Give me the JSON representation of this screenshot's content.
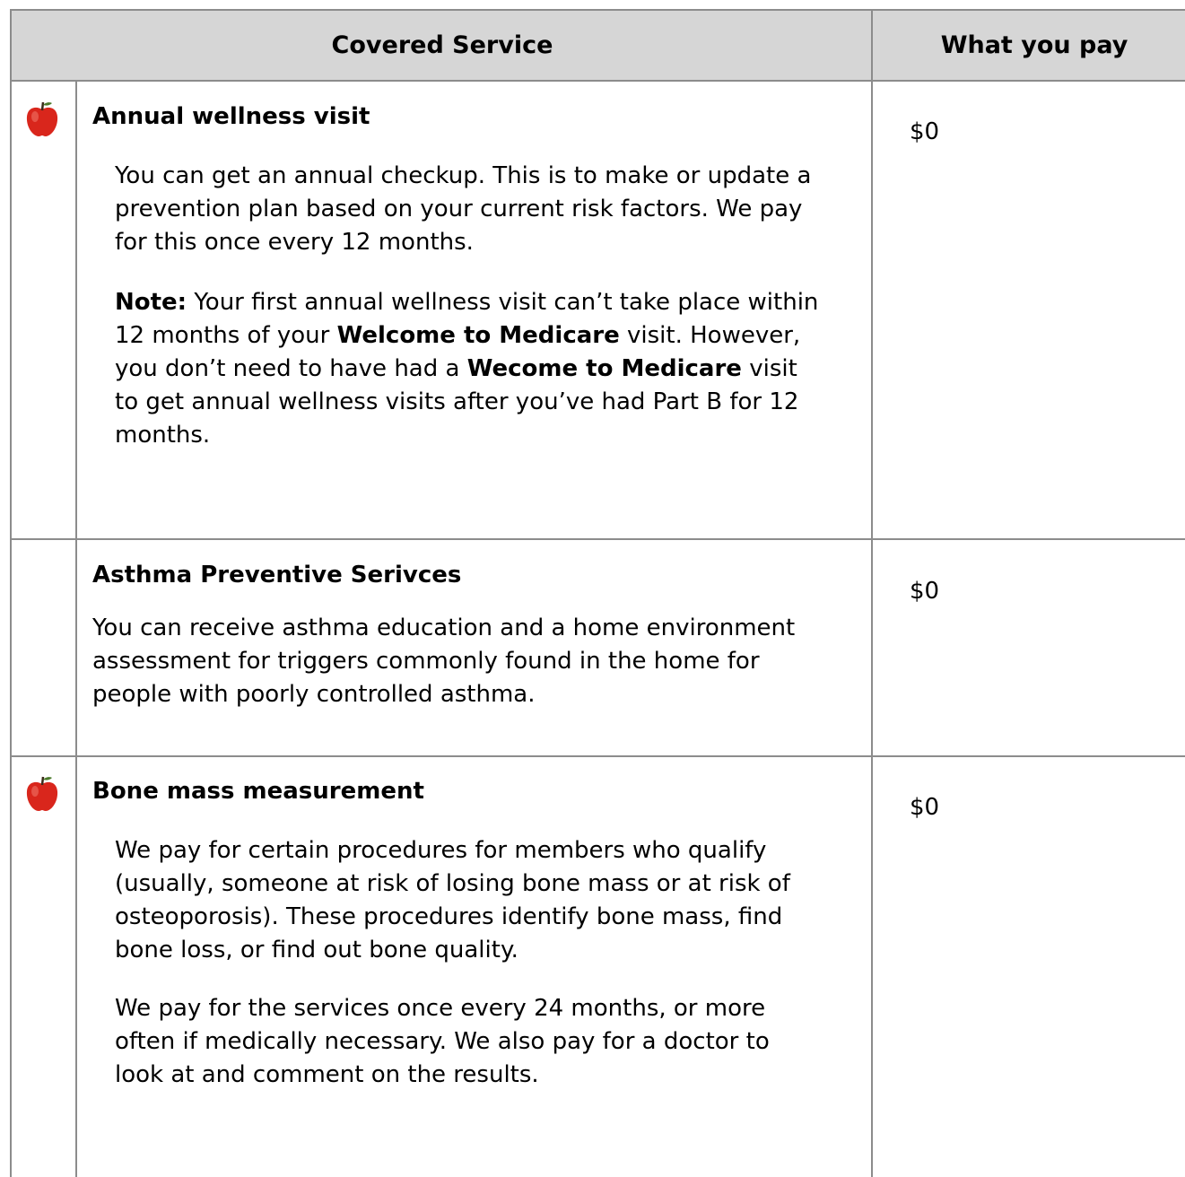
{
  "header": {
    "service": "Covered Service",
    "pay": "What you pay"
  },
  "rows": [
    {
      "icon": "apple-icon",
      "title": "Annual wellness visit",
      "price": "$0",
      "p1": "You can get an annual checkup. This is to make or update a prevention plan based on your current risk factors. We pay for this once every 12 months.",
      "note_label": "Note:",
      "note_t1": " Your first annual wellness visit can’t take place within 12 months of your ",
      "note_b1": "Welcome to Medicare",
      "note_t2": " visit. However, you don’t need to have had a ",
      "note_b2": "Wecome to Medicare",
      "note_t3": " visit to get annual wellness visits after you’ve had Part B for 12 months."
    },
    {
      "title": "Asthma Preventive Serivces",
      "price": "$0",
      "p1": "You can receive asthma education and a home environment assessment for triggers commonly found in the home for people with poorly controlled asthma."
    },
    {
      "icon": "apple-icon",
      "title": "Bone mass measurement",
      "price": "$0",
      "p1": "We pay for certain procedures for members who qualify (usually, someone at risk of losing bone mass or at risk of osteoporosis). These procedures identify bone mass, find bone loss, or find out bone quality.",
      "p2": "We pay for the services once every 24 months, or more often if medically necessary. We also pay for a doctor to look at and comment on the results."
    }
  ],
  "colors": {
    "header_bg": "#d6d6d6",
    "border": "#8c8c8c",
    "apple_red": "#d9261c"
  }
}
